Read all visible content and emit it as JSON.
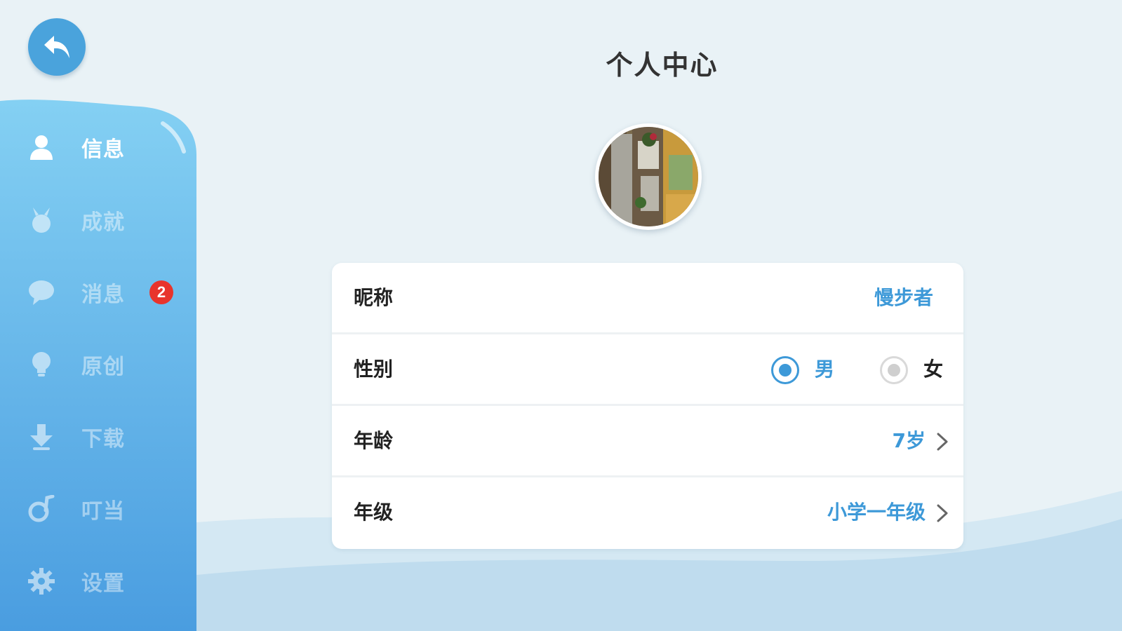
{
  "header": {
    "title": "个人中心"
  },
  "sidebar": {
    "items": [
      {
        "label": "信息",
        "icon": "person-icon",
        "active": true
      },
      {
        "label": "成就",
        "icon": "medal-icon",
        "active": false
      },
      {
        "label": "消息",
        "icon": "chat-bubble-icon",
        "active": false,
        "badge": "2"
      },
      {
        "label": "原创",
        "icon": "lightbulb-icon",
        "active": false
      },
      {
        "label": "下载",
        "icon": "download-icon",
        "active": false
      },
      {
        "label": "叮当",
        "icon": "music-note-icon",
        "active": false
      },
      {
        "label": "设置",
        "icon": "gear-icon",
        "active": false
      }
    ]
  },
  "profile": {
    "nickname_label": "昵称",
    "nickname_value": "慢步者",
    "gender_label": "性别",
    "gender_options": [
      {
        "label": "男",
        "selected": true
      },
      {
        "label": "女",
        "selected": false
      }
    ],
    "age_label": "年龄",
    "age_value": "7岁",
    "grade_label": "年级",
    "grade_value": "小学一年级"
  },
  "colors": {
    "accent": "#3d99d8",
    "sidebar_top": "#7ccbf1",
    "sidebar_bottom": "#4a9fe0",
    "badge": "#e8342c",
    "background": "#e9f2f6"
  }
}
